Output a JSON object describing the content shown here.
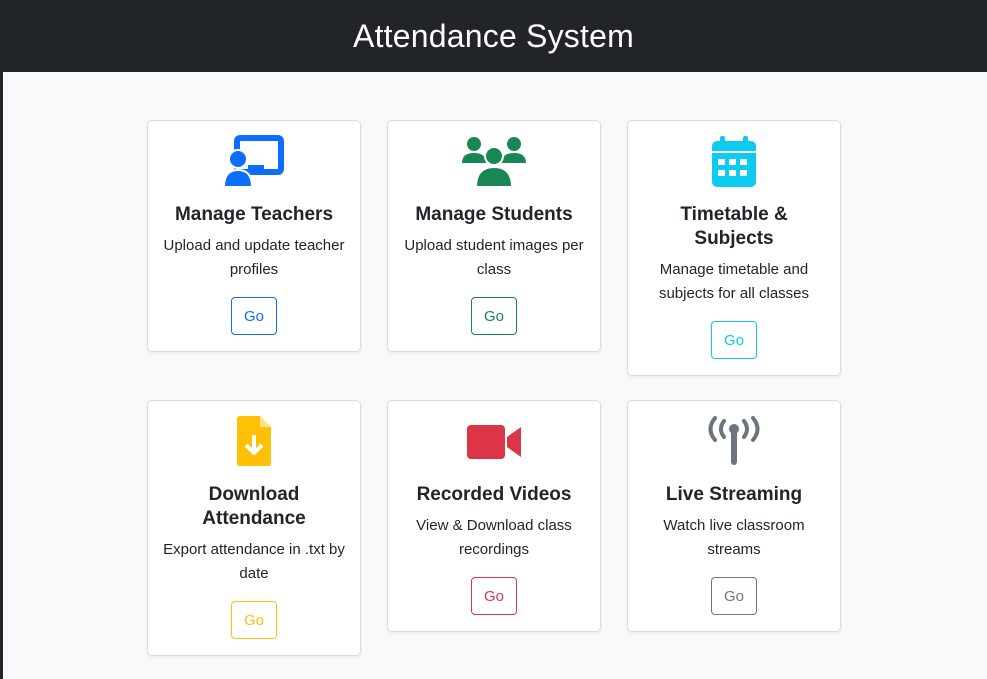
{
  "header": {
    "title": "Attendance System"
  },
  "cards": [
    {
      "title": "Manage Teachers",
      "description": "Upload and update teacher profiles",
      "button": "Go",
      "icon": "teacher-board-icon",
      "color": "#0d6efd"
    },
    {
      "title": "Manage Students",
      "description": "Upload student images per class",
      "button": "Go",
      "icon": "students-group-icon",
      "color": "#198754"
    },
    {
      "title": "Timetable & Subjects",
      "description": "Manage timetable and subjects for all classes",
      "button": "Go",
      "icon": "calendar-icon",
      "color": "#0dcaf0"
    },
    {
      "title": "Download Attendance",
      "description": "Export attendance in .txt by date",
      "button": "Go",
      "icon": "file-download-icon",
      "color": "#ffc107"
    },
    {
      "title": "Recorded Videos",
      "description": "View & Download class recordings",
      "button": "Go",
      "icon": "video-camera-icon",
      "color": "#dc3545"
    },
    {
      "title": "Live Streaming",
      "description": "Watch live classroom streams",
      "button": "Go",
      "icon": "broadcast-antenna-icon",
      "color": "#6c757d"
    }
  ]
}
